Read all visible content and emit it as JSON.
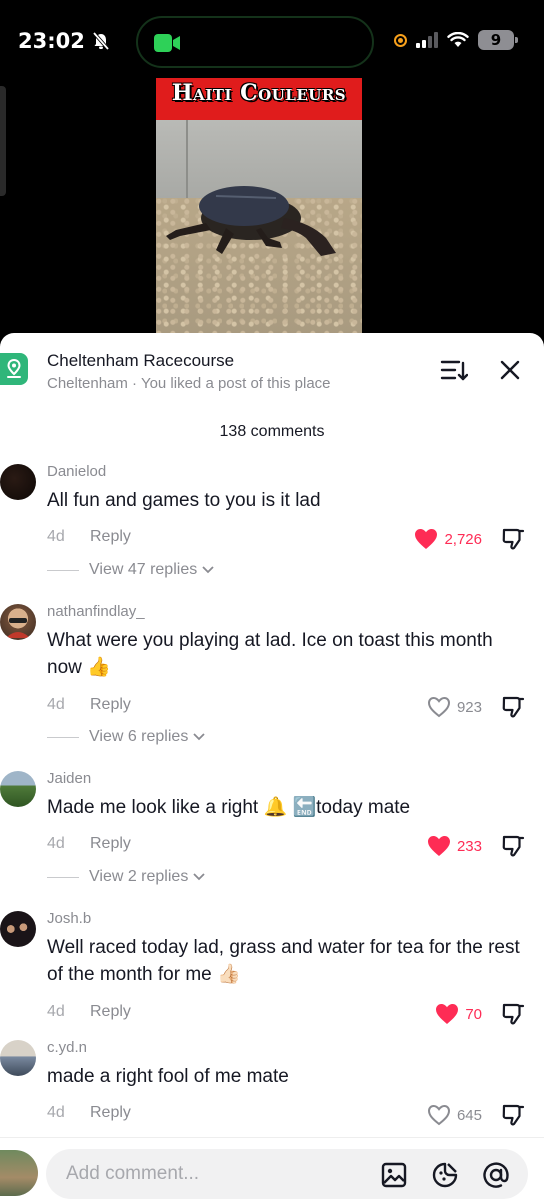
{
  "status_bar": {
    "time": "23:02",
    "battery": "9",
    "icons": [
      "bell-slash-icon",
      "facetime-icon",
      "orange-dot-icon",
      "signal-icon",
      "wifi-icon",
      "battery-icon"
    ]
  },
  "video": {
    "overlay_title": "Haiti Couleurs"
  },
  "place": {
    "name": "Cheltenham Racecourse",
    "subtitle": "Cheltenham · You liked a post of this place"
  },
  "comment_count": "138 comments",
  "comments": [
    {
      "user": "Danielod",
      "text": "All fun and games to you is it lad",
      "date": "4d",
      "reply": "Reply",
      "likes": "2,726",
      "liked": true,
      "view_replies": "View 47 replies"
    },
    {
      "user": "nathanfindlay_",
      "text": "What were you playing at lad. Ice on toast this month now",
      "emoji": "👍",
      "date": "4d",
      "reply": "Reply",
      "likes": "923",
      "liked": false,
      "view_replies": "View 6 replies"
    },
    {
      "user": "Jaiden",
      "text_a": "Made me look like a right",
      "emoji_a": "🔔",
      "emoji_b": "🔚",
      "text_b": "today mate",
      "date": "4d",
      "reply": "Reply",
      "likes": "233",
      "liked": true,
      "view_replies": "View 2 replies"
    },
    {
      "user": "Josh.b",
      "text": "Well raced today lad, grass and water for tea for the rest of the month for me",
      "emoji": "👍🏻",
      "date": "4d",
      "reply": "Reply",
      "likes": "70",
      "liked": true
    },
    {
      "user": "c.yd.n",
      "text": "made a right fool of me mate",
      "date": "4d",
      "reply": "Reply",
      "likes": "645",
      "liked": false
    }
  ],
  "composer": {
    "placeholder": "Add comment..."
  },
  "colors": {
    "accent_like": "#fe2c55",
    "place_icon": "#2fb67a",
    "text_primary": "#161823",
    "text_secondary": "#8a8b91"
  }
}
